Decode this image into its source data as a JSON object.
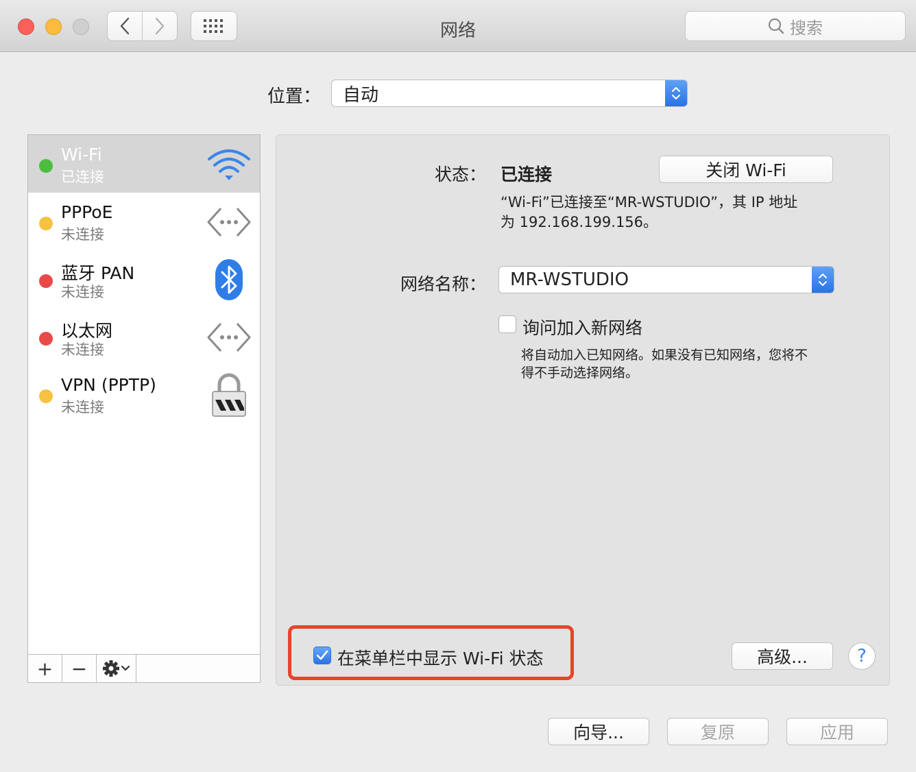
{
  "window": {
    "title": "网络",
    "search_placeholder": "搜索"
  },
  "location": {
    "label": "位置：",
    "value": "自动"
  },
  "services": [
    {
      "name": "Wi-Fi",
      "status": "已连接",
      "dot_color": "#4cbd3e",
      "icon": "wifi-icon"
    },
    {
      "name": "PPPoE",
      "status": "未连接",
      "dot_color": "#f5c242",
      "icon": "network-arrows-icon"
    },
    {
      "name": "蓝牙 PAN",
      "status": "未连接",
      "dot_color": "#e84a4a",
      "icon": "bluetooth-icon"
    },
    {
      "name": "以太网",
      "status": "未连接",
      "dot_color": "#e84a4a",
      "icon": "network-arrows-icon"
    },
    {
      "name": "VPN (PPTP)",
      "status": "未连接",
      "dot_color": "#f5c242",
      "icon": "vpn-lock-icon"
    }
  ],
  "sidebar_footer": {
    "add": "+",
    "remove": "−"
  },
  "detail": {
    "status_label": "状态：",
    "status_value": "已连接",
    "turn_off_button": "关闭 Wi-Fi",
    "status_desc_line1": "“Wi-Fi”已连接至“MR-WSTUDIO”，其 IP 地址",
    "status_desc_line2": "为 192.168.199.156。",
    "network_name_label": "网络名称：",
    "network_name_value": "MR-WSTUDIO",
    "ask_join_label": "询问加入新网络",
    "ask_join_checked": false,
    "ask_join_desc_line1": "将自动加入已知网络。如果没有已知网络，您将不",
    "ask_join_desc_line2": "得不手动选择网络。",
    "show_in_menubar_label": "在菜单栏中显示 Wi-Fi 状态",
    "show_in_menubar_checked": true,
    "advanced_button": "高级...",
    "help_button": "?"
  },
  "footer": {
    "assistant_button": "向导...",
    "revert_button": "复原",
    "apply_button": "应用"
  },
  "colors": {
    "accent": "#2d74e8",
    "highlight_box": "#e8442a"
  }
}
